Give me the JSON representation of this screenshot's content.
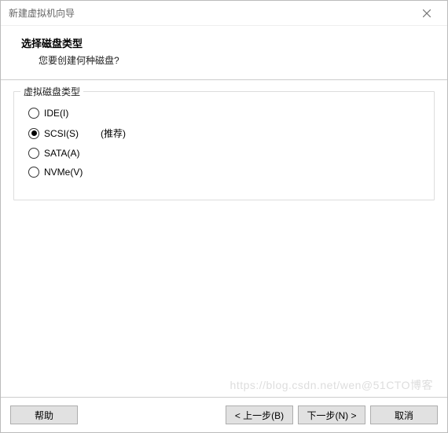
{
  "window": {
    "title": "新建虚拟机向导"
  },
  "header": {
    "title": "选择磁盘类型",
    "subtitle": "您要创建何种磁盘?"
  },
  "group": {
    "legend": "虚拟磁盘类型",
    "recommend_label": "(推荐)",
    "options": [
      {
        "label": "IDE(I)",
        "checked": false,
        "recommend": false
      },
      {
        "label": "SCSI(S)",
        "checked": true,
        "recommend": true
      },
      {
        "label": "SATA(A)",
        "checked": false,
        "recommend": false
      },
      {
        "label": "NVMe(V)",
        "checked": false,
        "recommend": false
      }
    ]
  },
  "footer": {
    "help": "帮助",
    "back": "< 上一步(B)",
    "next": "下一步(N) >",
    "cancel": "取消"
  },
  "watermark": "https://blog.csdn.net/wen@51CTO博客"
}
